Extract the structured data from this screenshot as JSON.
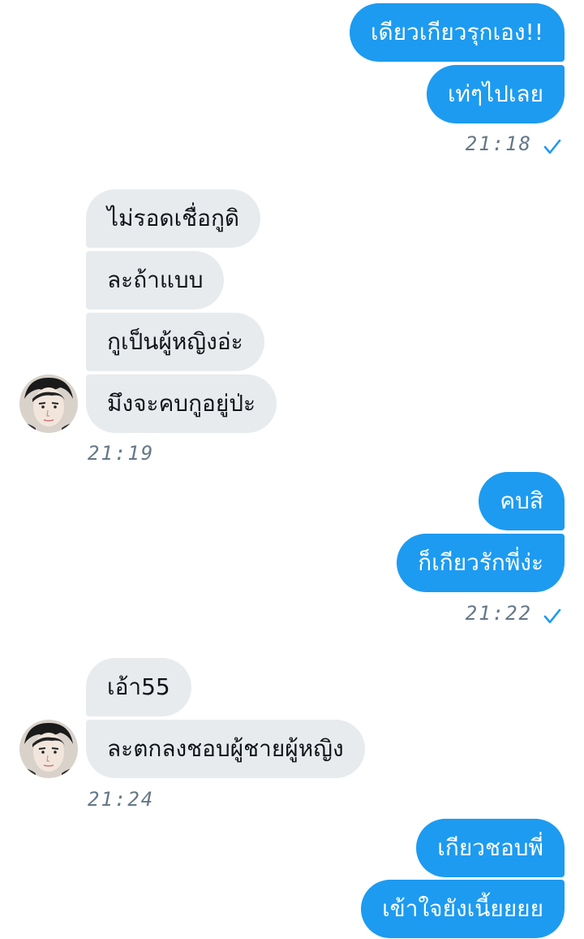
{
  "colors": {
    "outgoing_bubble": "#1d9bf0",
    "incoming_bubble": "#e8ebee",
    "timestamp_text": "#657786",
    "read_check": "#1d9bf0"
  },
  "icons": {
    "read_receipt": "checkmark-icon",
    "avatar": "user-avatar"
  },
  "groups": [
    {
      "sender": "me",
      "messages": [
        "เดียวเกียวรุกเอง!!",
        "เท่ๆไปเลย"
      ],
      "time": "21:18",
      "read": true
    },
    {
      "sender": "them",
      "messages": [
        "ไม่รอดเชื่อกูดิ",
        "ละถ้าแบบ",
        "กูเป็นผู้หญิงอ่ะ",
        "มึงจะคบกูอยู่ป่ะ"
      ],
      "time": "21:19"
    },
    {
      "sender": "me",
      "messages": [
        "คบสิ",
        "ก็เกียวรักพี่ง่ะ"
      ],
      "time": "21:22",
      "read": true
    },
    {
      "sender": "them",
      "messages": [
        "เอ้า55",
        "ละตกลงชอบผู้ชายผู้หญิง"
      ],
      "time": "21:24"
    },
    {
      "sender": "me",
      "messages": [
        "เกียวชอบพี่",
        "เข้าใจยังเนี้ยยยย"
      ]
    }
  ]
}
